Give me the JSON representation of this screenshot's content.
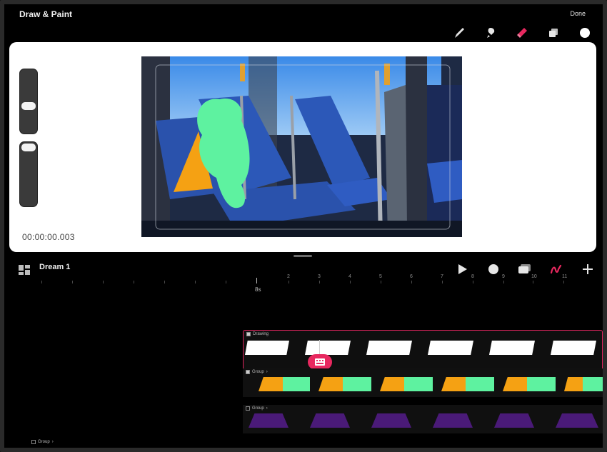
{
  "app": {
    "title": "Draw & Paint",
    "done_label": "Done"
  },
  "toolbar": {
    "tools": [
      {
        "name": "brush-icon",
        "color": "#e6e6e6"
      },
      {
        "name": "smudge-icon",
        "color": "#e6e6e6"
      },
      {
        "name": "eraser-icon",
        "color": "#e8285f"
      },
      {
        "name": "layers-icon",
        "color": "#e6e6e6"
      },
      {
        "name": "color-icon",
        "color": "#ffffff"
      }
    ]
  },
  "canvas": {
    "timecode": "00:00:00.003",
    "brush_size_level": 0.55,
    "opacity_level": 0.05
  },
  "timeline": {
    "project_name": "Dream 1",
    "ruler_labels": [
      "2",
      "3",
      "4",
      "5",
      "6",
      "7",
      "8",
      "9",
      "10",
      "11"
    ],
    "playhead_label": "8s",
    "tracks": {
      "drawing_label": "Drawing",
      "group1_label": "Group",
      "group2_label": "Group",
      "left_group_label": "Group"
    },
    "colors": {
      "accent": "#e8285f",
      "orange": "#f5a113",
      "green": "#5ef2a0",
      "purple": "#4a1a78"
    }
  }
}
